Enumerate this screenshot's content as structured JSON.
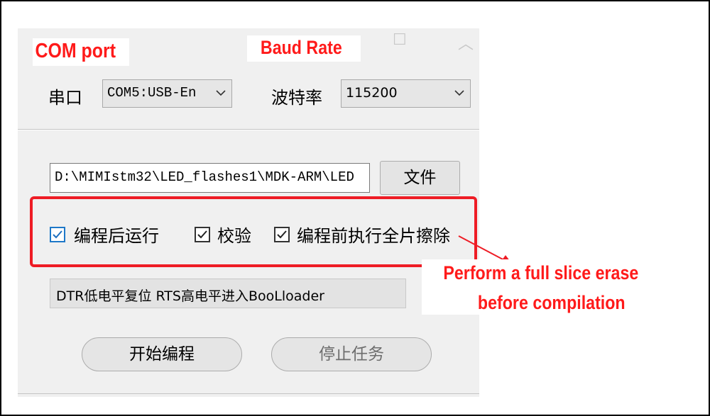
{
  "annotations": {
    "com_port": "COM port",
    "baud_rate": "Baud Rate",
    "note_line1": "Perform  a  full  slice  erase",
    "note_line2": "before  compilation",
    "highlight_color": "#ee1c25"
  },
  "serial": {
    "port_label": "串口",
    "port_value": "COM5:USB-En",
    "baud_label": "波特率",
    "baud_value": "115200"
  },
  "file": {
    "path_value": "D:\\MIMIstm32\\LED_flashes1\\MDK-ARM\\LED",
    "browse_label": "文件"
  },
  "options": {
    "run_after_program": {
      "label": "编程后运行",
      "checked": true
    },
    "verify": {
      "label": "校验",
      "checked": true
    },
    "full_erase_before_program": {
      "label": "编程前执行全片擦除",
      "checked": true
    }
  },
  "boot_mode": {
    "value": "DTR低电平复位 RTS高电平进入BooLloader"
  },
  "actions": {
    "start_label": "开始编程",
    "stop_label": "停止任务"
  }
}
